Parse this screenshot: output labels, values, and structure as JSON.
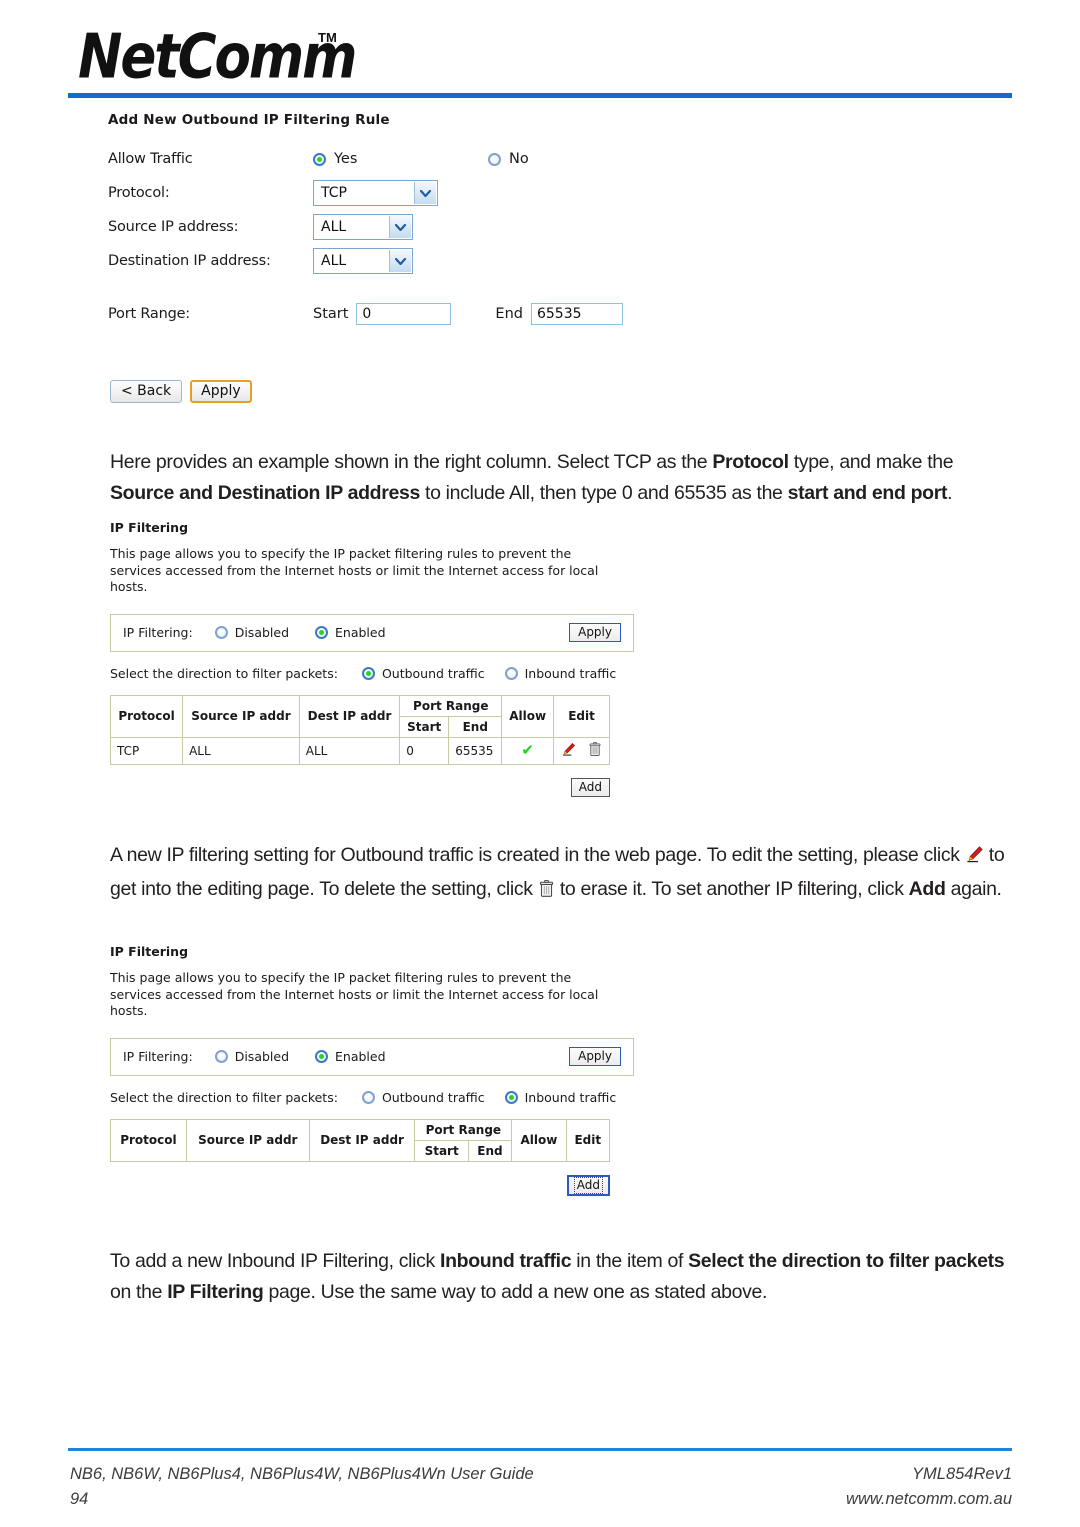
{
  "header": {
    "brand": "NetComm",
    "trademark": "TM"
  },
  "form": {
    "title": "Add New Outbound IP Filtering Rule",
    "allow_traffic_label": "Allow Traffic",
    "allow_yes": "Yes",
    "allow_no": "No",
    "allow_selected": "Yes",
    "protocol_label": "Protocol:",
    "protocol_value": "TCP",
    "source_label": "Source IP address:",
    "source_value": "ALL",
    "dest_label": "Destination IP address:",
    "dest_value": "ALL",
    "port_range_label": "Port Range:",
    "start_label": "Start",
    "start_value": "0",
    "end_label": "End",
    "end_value": "65535",
    "back_button": "< Back",
    "apply_button": "Apply"
  },
  "paragraphs": {
    "p1_a": "Here provides an example shown in the right column. Select TCP as the ",
    "p1_b": "Protocol",
    "p1_c": " type, and make the ",
    "p1_d": "Source and Destination IP address",
    "p1_e": " to include All, then type 0 and 65535 as the ",
    "p1_f": "start and end port",
    "p1_g": ".",
    "p2_a": "A new IP filtering setting for Outbound traffic is created in the web page. To edit the setting, please click ",
    "p2_b": " to get into the editing page. To delete the setting, click ",
    "p2_c": " to erase it. To set another IP filtering, click ",
    "p2_d": "Add",
    "p2_e": " again.",
    "p3_a": "To add a new Inbound IP Filtering, click ",
    "p3_b": "Inbound traffic",
    "p3_c": " in the item of ",
    "p3_d": "Select the direction to filter packets",
    "p3_e": " on the ",
    "p3_f": "IP Filtering",
    "p3_g": " page. Use the same way to add a new one as stated above."
  },
  "panel1": {
    "title": "IP Filtering",
    "description": "This page allows you to specify the IP packet filtering rules to prevent the services accessed from the Internet hosts or limit the Internet access for local hosts.",
    "filter_label": "IP Filtering:",
    "disabled_label": "Disabled",
    "enabled_label": "Enabled",
    "selected_state": "Enabled",
    "apply_label": "Apply",
    "direction_label": "Select the direction to filter packets:",
    "outbound_label": "Outbound traffic",
    "inbound_label": "Inbound traffic",
    "direction_selected": "Outbound traffic",
    "add_label": "Add",
    "table": {
      "headers": {
        "protocol": "Protocol",
        "source": "Source IP addr",
        "dest": "Dest IP addr",
        "port_range": "Port Range",
        "start": "Start",
        "end": "End",
        "allow": "Allow",
        "edit": "Edit"
      },
      "rows": [
        {
          "protocol": "TCP",
          "source": "ALL",
          "dest": "ALL",
          "start": "0",
          "end": "65535",
          "allow": "allowed-check-icon",
          "edit": [
            "pencil-icon",
            "trash-icon"
          ]
        }
      ]
    }
  },
  "panel2": {
    "title": "IP Filtering",
    "description": "This page allows you to specify the IP packet filtering rules to prevent the services accessed from the Internet hosts or limit the Internet access for local hosts.",
    "filter_label": "IP Filtering:",
    "disabled_label": "Disabled",
    "enabled_label": "Enabled",
    "selected_state": "Enabled",
    "apply_label": "Apply",
    "direction_label": "Select the direction to filter packets:",
    "outbound_label": "Outbound traffic",
    "inbound_label": "Inbound traffic",
    "direction_selected": "Inbound traffic",
    "add_label": "Add",
    "table": {
      "headers": {
        "protocol": "Protocol",
        "source": "Source IP addr",
        "dest": "Dest IP addr",
        "port_range": "Port Range",
        "start": "Start",
        "end": "End",
        "allow": "Allow",
        "edit": "Edit"
      },
      "rows": []
    }
  },
  "footer": {
    "left_line1": "NB6, NB6W, NB6Plus4, NB6Plus4W, NB6Plus4Wn User Guide",
    "left_line2": "94",
    "right_line1": "YML854Rev1",
    "right_line2": "www.netcomm.com.au"
  },
  "colors": {
    "rule_blue": "#1569d6",
    "footer_blue": "#1f84d6",
    "focus_orange": "#e8a020",
    "focus_blue": "#2b59c3",
    "radio_green": "#1fd81f",
    "check_green": "#17d517",
    "table_border": "#c9c9a6"
  }
}
